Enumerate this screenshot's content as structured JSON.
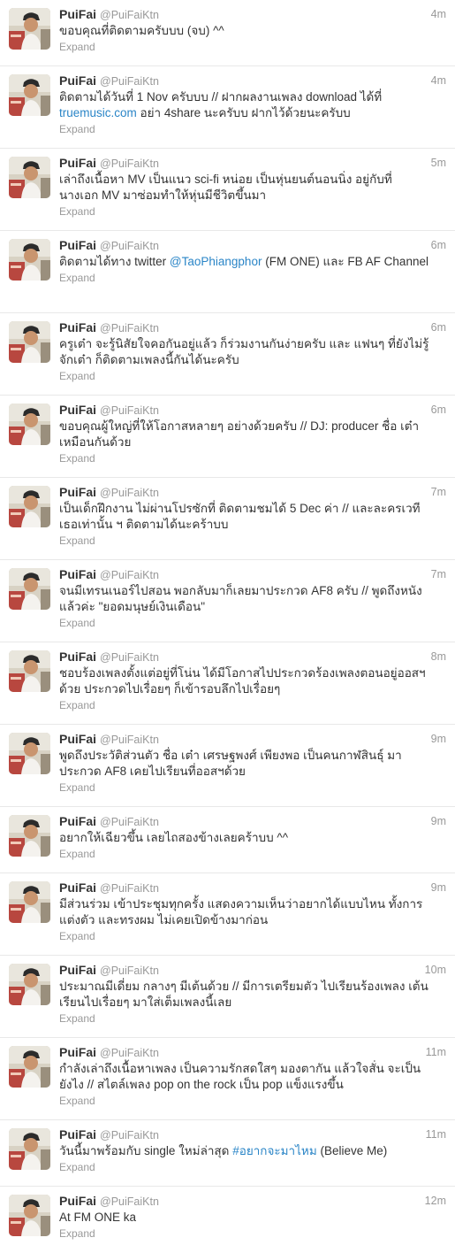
{
  "timeline": {
    "expand_label": "Expand",
    "tweets": [
      {
        "name": "PuiFai",
        "handle": "@PuiFaiKtn",
        "time": "4m",
        "text": "ขอบคุณที่ติดตามครับบบ (จบ) ^^"
      },
      {
        "name": "PuiFai",
        "handle": "@PuiFaiKtn",
        "time": "4m",
        "text_before": "ติดตามได้วันที่ 1 Nov ครับบบ // ฝากผลงานเพลง download ได้ที่ ",
        "link": "truemusic.com",
        "text_after": " อย่า 4share นะครับบ ฝากไว้ด้วยนะครับบ"
      },
      {
        "name": "PuiFai",
        "handle": "@PuiFaiKtn",
        "time": "5m",
        "text": "เล่าถึงเนื้อหา MV เป็นแนว sci-fi หน่อย เป็นหุ่นยนต์นอนนิ่ง อยู่กับที่ นางเอก MV มาซ่อมทำให้หุ่นมีชีวิตขึ้นมา"
      },
      {
        "name": "PuiFai",
        "handle": "@PuiFaiKtn",
        "time": "6m",
        "text_before": "ติดตามได้ทาง twitter ",
        "link": "@TaoPhiangphor",
        "text_after": " (FM ONE) และ FB AF Channel"
      },
      {
        "name": "PuiFai",
        "handle": "@PuiFaiKtn",
        "time": "6m",
        "text": "ครูเต๋า จะรู้นิสัยใจคอกันอยู่แล้ว ก็ร่วมงานกันง่ายครับ และ แฟนๆ ที่ยังไม่รู้จักเต๋า ก็ติดตามเพลงนี้กันได้นะครับ"
      },
      {
        "name": "PuiFai",
        "handle": "@PuiFaiKtn",
        "time": "6m",
        "text": "ขอบคุณผู้ใหญ่ที่ให้โอกาสหลายๆ อย่างด้วยครับ // DJ: producer ชื่อ เต๋า เหมือนกันด้วย"
      },
      {
        "name": "PuiFai",
        "handle": "@PuiFaiKtn",
        "time": "7m",
        "text": "เป็นเด็กฝึกงาน ไม่ผ่านโปรซักที่ ติดตามชมได้ 5 Dec ค่า // และละครเวทีเธอเท่านั้น ฯ ติดตามได้นะคร้าบบ"
      },
      {
        "name": "PuiFai",
        "handle": "@PuiFaiKtn",
        "time": "7m",
        "text": "จนมีเทรนเนอร์ไปสอน พอกลับมาก็เลยมาประกวด AF8 ครับ // พูดถึงหนังแล้วค่ะ \"ยอดมนุษย์เงินเดือน\""
      },
      {
        "name": "PuiFai",
        "handle": "@PuiFaiKtn",
        "time": "8m",
        "text": "ชอบร้องเพลงตั้งแต่อยู่ที่โน่น ได้มีโอกาสไปประกวดร้องเพลงตอนอยู่ออสฯ ด้วย ประกวดไปเรื่อยๆ ก็เข้ารอบลึกไปเรื่อยๆ"
      },
      {
        "name": "PuiFai",
        "handle": "@PuiFaiKtn",
        "time": "9m",
        "text": "พูดถึงประวัติส่วนตัว ชื่อ เต๋า เศรษฐพงศ์ เพียงพอ เป็นคนกาฬสินธุ์ มาประกวด AF8 เคยไปเรียนที่ออสฯด้วย"
      },
      {
        "name": "PuiFai",
        "handle": "@PuiFaiKtn",
        "time": "9m",
        "text": "อยากให้เฉียวขึ้น เลยไถสองข้างเลยคร้าบบ ^^"
      },
      {
        "name": "PuiFai",
        "handle": "@PuiFaiKtn",
        "time": "9m",
        "text": "มีส่วนร่วม เข้าประชุมทุกครั้ง แสดงความเห็นว่าอยากได้แบบไหน ทั้งการแต่งตัว และทรงผม ไม่เคยเปิดข้างมาก่อน"
      },
      {
        "name": "PuiFai",
        "handle": "@PuiFaiKtn",
        "time": "10m",
        "text": "ประมาณมีเดี่ยม กลางๆ มีเต้นด้วย // มีการเตรียมตัว ไปเรียนร้องเพลง เต้นเรียนไปเรื่อยๆ มาใส่เต็มเพลงนี้เลย"
      },
      {
        "name": "PuiFai",
        "handle": "@PuiFaiKtn",
        "time": "11m",
        "text": "กำลังเล่าถึงเนื้อหาเพลง เป็นความรักสดใสๆ มองตากัน แล้วใจสั่น จะเป็นยังไง // สไตล์เพลง pop on the rock เป็น pop แข็งแรงขึ้น"
      },
      {
        "name": "PuiFai",
        "handle": "@PuiFaiKtn",
        "time": "11m",
        "text_before": "วันนี้มาพร้อมกับ single ใหม่ล่าสุด ",
        "link": "#อยากจะมาไหม",
        "text_after": " (Believe Me)"
      },
      {
        "name": "PuiFai",
        "handle": "@PuiFaiKtn",
        "time": "12m",
        "text": "At FM ONE ka"
      }
    ]
  }
}
